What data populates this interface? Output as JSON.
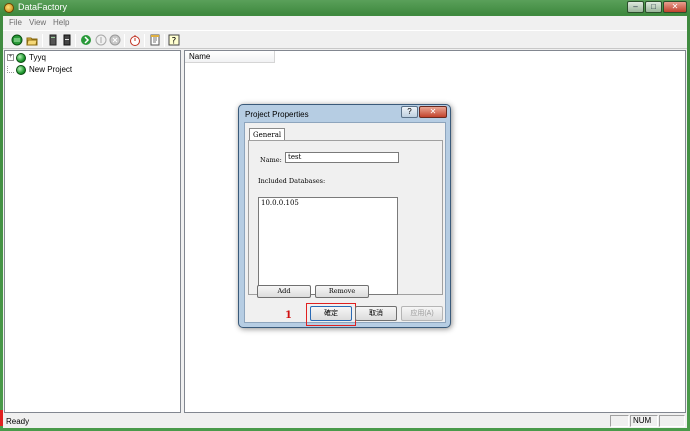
{
  "window": {
    "title": "DataFactory"
  },
  "menu": [
    "File",
    "View",
    "Help"
  ],
  "toolbar": {
    "buttons": [
      "new-project-icon",
      "open-icon",
      "server-icon",
      "database-icon",
      "run-icon",
      "pause-icon",
      "stop-icon",
      "timer-icon",
      "properties-icon",
      "help-icon"
    ]
  },
  "tree": {
    "items": [
      {
        "label": "Tyyq",
        "expander": "+"
      },
      {
        "label": "New Project"
      }
    ]
  },
  "list": {
    "columns": [
      "Name"
    ]
  },
  "status": {
    "text": "Ready",
    "num": "NUM"
  },
  "dialog": {
    "title": "Project Properties",
    "help_glyph": "?",
    "close_glyph": "✕",
    "tab": "General",
    "name_label": "Name:",
    "name_value": "test",
    "databases_label": "Included Databases:",
    "databases": [
      "10.0.0.105"
    ],
    "add_label": "Add",
    "remove_label": "Remove",
    "ok_label": "確定",
    "cancel_label": "取消",
    "apply_label": "应用(A)",
    "annotation": "1"
  }
}
